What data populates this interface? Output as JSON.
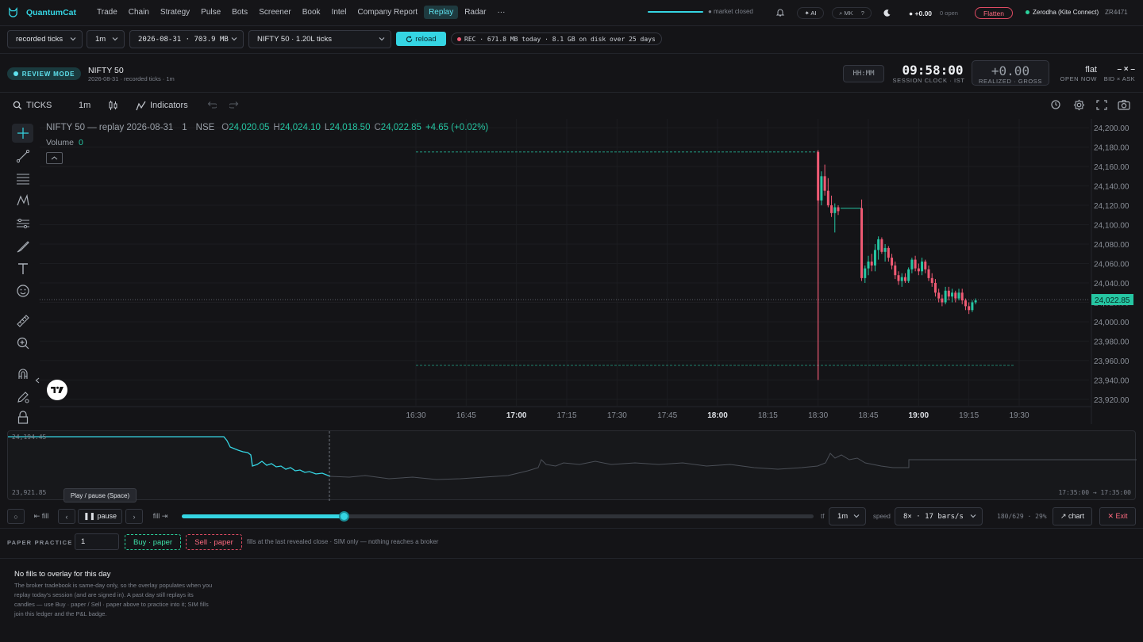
{
  "brand": {
    "name": "QuantumCat",
    "icon": "cat-icon",
    "color": "#35d5e3"
  },
  "nav": {
    "items": [
      "Trade",
      "Chain",
      "Strategy",
      "Pulse",
      "Bots",
      "Screener",
      "Book",
      "Intel",
      "Company Report",
      "Replay",
      "Radar",
      "···"
    ],
    "active": "Replay"
  },
  "status": {
    "market": "● market closed",
    "ai": "✦ AI",
    "mk": "⌕ MK",
    "help": "?",
    "pnl_pill": "● +0.00",
    "open_pill": "0 open",
    "flatten": "Flatten",
    "broker": "Zerodha (Kite Connect)",
    "broker_id": "ZR4471"
  },
  "toolbar": {
    "source": "recorded ticks",
    "interval": "1m",
    "session": "2026-08-31 · 703.9 MB",
    "symbol": "NIFTY 50 · 1.20L ticks",
    "reload": "reload",
    "rec": "REC · 671.8 MB today · 8.1 GB on disk over 25 days"
  },
  "review": {
    "badge": "REVIEW MODE",
    "title": "NIFTY 50",
    "subtitle": "2026-08-31 · recorded ticks · 1m",
    "hhmm": "HH:MM",
    "clock": "09:58:00",
    "clock_label": "SESSION CLOCK · IST",
    "pnl": "+0.00",
    "pnl_label": "REALIZED · GROSS",
    "position": "flat",
    "position_label": "OPEN NOW",
    "bidask": "– × –",
    "bidask_label": "BID × ASK"
  },
  "chart_toolbar": {
    "symbol_search": "TICKS",
    "interval": "1m",
    "indicators": "Indicators"
  },
  "chart_data": {
    "type": "candlestick",
    "legend": {
      "title": "NIFTY 50 — replay 2026-08-31",
      "interval": "1",
      "exchange": "NSE",
      "o_label": "O",
      "open": "24,020.05",
      "h_label": "H",
      "high": "24,024.10",
      "l_label": "L",
      "low": "24,018.50",
      "c_label": "C",
      "close": "24,022.85",
      "change": "+4.65 (+0.02%)",
      "volume_label": "Volume",
      "volume": "0"
    },
    "y_ticks": [
      "24,200.00",
      "24,180.00",
      "24,160.00",
      "24,140.00",
      "24,120.00",
      "24,100.00",
      "24,080.00",
      "24,060.00",
      "24,040.00",
      "24,020.00",
      "24,000.00",
      "23,980.00",
      "23,960.00",
      "23,940.00",
      "23,920.00"
    ],
    "ylim": [
      23915,
      24205
    ],
    "x_ticks": [
      {
        "label": "16:30",
        "bold": false
      },
      {
        "label": "16:45",
        "bold": false
      },
      {
        "label": "17:00",
        "bold": true
      },
      {
        "label": "17:15",
        "bold": false
      },
      {
        "label": "17:30",
        "bold": false
      },
      {
        "label": "17:45",
        "bold": false
      },
      {
        "label": "18:00",
        "bold": true
      },
      {
        "label": "18:15",
        "bold": false
      },
      {
        "label": "18:30",
        "bold": false
      },
      {
        "label": "18:45",
        "bold": false
      },
      {
        "label": "19:00",
        "bold": true
      },
      {
        "label": "19:15",
        "bold": false
      },
      {
        "label": "19:30",
        "bold": false
      }
    ],
    "last_price": "24,022.85",
    "last_value": 24022.85,
    "hi_line": 24175,
    "lo_line": 23955,
    "spike": {
      "x": "18:30",
      "high": 24175,
      "low": 23940
    },
    "candles": [
      {
        "t": "18:30",
        "o": 24175,
        "h": 24177,
        "l": 24122,
        "c": 24125
      },
      {
        "t": "18:31",
        "o": 24125,
        "h": 24155,
        "l": 24120,
        "c": 24150
      },
      {
        "t": "18:32",
        "o": 24150,
        "h": 24162,
        "l": 24130,
        "c": 24135
      },
      {
        "t": "18:33",
        "o": 24135,
        "h": 24148,
        "l": 24118,
        "c": 24120
      },
      {
        "t": "18:34",
        "o": 24120,
        "h": 24130,
        "l": 24108,
        "c": 24112
      },
      {
        "t": "18:35",
        "o": 24112,
        "h": 24122,
        "l": 24092,
        "c": 24118
      },
      {
        "t": "18:36",
        "o": 24118,
        "h": 24120,
        "l": 24110,
        "c": 24114
      },
      {
        "t": "18:43",
        "o": 24117,
        "h": 24126,
        "l": 24042,
        "c": 24045
      },
      {
        "t": "18:44",
        "o": 24045,
        "h": 24058,
        "l": 24040,
        "c": 24055
      },
      {
        "t": "18:45",
        "o": 24055,
        "h": 24068,
        "l": 24048,
        "c": 24062
      },
      {
        "t": "18:46",
        "o": 24062,
        "h": 24070,
        "l": 24052,
        "c": 24058
      },
      {
        "t": "18:47",
        "o": 24058,
        "h": 24080,
        "l": 24052,
        "c": 24074
      },
      {
        "t": "18:48",
        "o": 24074,
        "h": 24088,
        "l": 24064,
        "c": 24085
      },
      {
        "t": "18:49",
        "o": 24085,
        "h": 24087,
        "l": 24070,
        "c": 24072
      },
      {
        "t": "18:50",
        "o": 24072,
        "h": 24080,
        "l": 24062,
        "c": 24076
      },
      {
        "t": "18:51",
        "o": 24076,
        "h": 24078,
        "l": 24062,
        "c": 24066
      },
      {
        "t": "18:52",
        "o": 24066,
        "h": 24070,
        "l": 24054,
        "c": 24058
      },
      {
        "t": "18:53",
        "o": 24058,
        "h": 24062,
        "l": 24044,
        "c": 24048
      },
      {
        "t": "18:54",
        "o": 24048,
        "h": 24052,
        "l": 24038,
        "c": 24042
      },
      {
        "t": "18:55",
        "o": 24042,
        "h": 24050,
        "l": 24036,
        "c": 24046
      },
      {
        "t": "18:56",
        "o": 24046,
        "h": 24050,
        "l": 24040,
        "c": 24042
      },
      {
        "t": "18:57",
        "o": 24042,
        "h": 24056,
        "l": 24040,
        "c": 24054
      },
      {
        "t": "18:58",
        "o": 24054,
        "h": 24066,
        "l": 24050,
        "c": 24064
      },
      {
        "t": "18:59",
        "o": 24064,
        "h": 24068,
        "l": 24052,
        "c": 24055
      },
      {
        "t": "19:00",
        "o": 24055,
        "h": 24060,
        "l": 24048,
        "c": 24052
      },
      {
        "t": "19:01",
        "o": 24052,
        "h": 24066,
        "l": 24048,
        "c": 24062
      },
      {
        "t": "19:02",
        "o": 24062,
        "h": 24064,
        "l": 24050,
        "c": 24054
      },
      {
        "t": "19:03",
        "o": 24054,
        "h": 24058,
        "l": 24042,
        "c": 24045
      },
      {
        "t": "19:04",
        "o": 24045,
        "h": 24050,
        "l": 24036,
        "c": 24040
      },
      {
        "t": "19:05",
        "o": 24040,
        "h": 24044,
        "l": 24026,
        "c": 24030
      },
      {
        "t": "19:06",
        "o": 24030,
        "h": 24034,
        "l": 24020,
        "c": 24024
      },
      {
        "t": "19:07",
        "o": 24024,
        "h": 24028,
        "l": 24016,
        "c": 24020
      },
      {
        "t": "19:08",
        "o": 24020,
        "h": 24036,
        "l": 24018,
        "c": 24032
      },
      {
        "t": "19:09",
        "o": 24032,
        "h": 24036,
        "l": 24022,
        "c": 24026
      },
      {
        "t": "19:10",
        "o": 24026,
        "h": 24034,
        "l": 24020,
        "c": 24030
      },
      {
        "t": "19:11",
        "o": 24030,
        "h": 24032,
        "l": 24020,
        "c": 24024
      },
      {
        "t": "19:12",
        "o": 24024,
        "h": 24034,
        "l": 24022,
        "c": 24030
      },
      {
        "t": "19:13",
        "o": 24030,
        "h": 24034,
        "l": 24018,
        "c": 24022
      },
      {
        "t": "19:14",
        "o": 24022,
        "h": 24024,
        "l": 24012,
        "c": 24016
      },
      {
        "t": "19:15",
        "o": 24016,
        "h": 24020,
        "l": 24008,
        "c": 24012
      },
      {
        "t": "19:16",
        "o": 24012,
        "h": 24022,
        "l": 24010,
        "c": 24020
      },
      {
        "t": "19:17",
        "o": 24020,
        "h": 24024,
        "l": 24018,
        "c": 24022
      }
    ],
    "colors": {
      "up": "#26c6a3",
      "down": "#ef5a74",
      "last_price_bg": "#26c6a3"
    }
  },
  "navigator": {
    "top_value": "24,194.45",
    "bottom_value": "23,921.85",
    "range": "17:35:00 → 17:35:00",
    "tooltip": "Play / pause (Space)"
  },
  "playback": {
    "loop": "○",
    "fill_back": "⇤ fill",
    "prev": "‹",
    "pause": "❚❚ pause",
    "next": "›",
    "fill_fwd": "fill ⇥",
    "progress": 0.256,
    "tf_label": "tf",
    "tf": "1m",
    "speed_label": "speed",
    "speed": "8× · 17 bars/s",
    "position": "180/629 · 29%",
    "chart": "↗ chart",
    "exit": "✕ Exit"
  },
  "paper": {
    "label": "PAPER PRACTICE",
    "qty": "1",
    "buy": "Buy · paper",
    "sell": "Sell · paper",
    "note": "fills at the last revealed close · SIM only — nothing reaches a broker"
  },
  "fills": {
    "title": "No fills to overlay for this day",
    "body": "The broker tradebook is same-day only, so the overlay populates when you replay today's session (and are signed in). A past day still replays its candles — use Buy · paper / Sell · paper above to practice into it; SIM fills join this ledger and the P&L badge."
  }
}
